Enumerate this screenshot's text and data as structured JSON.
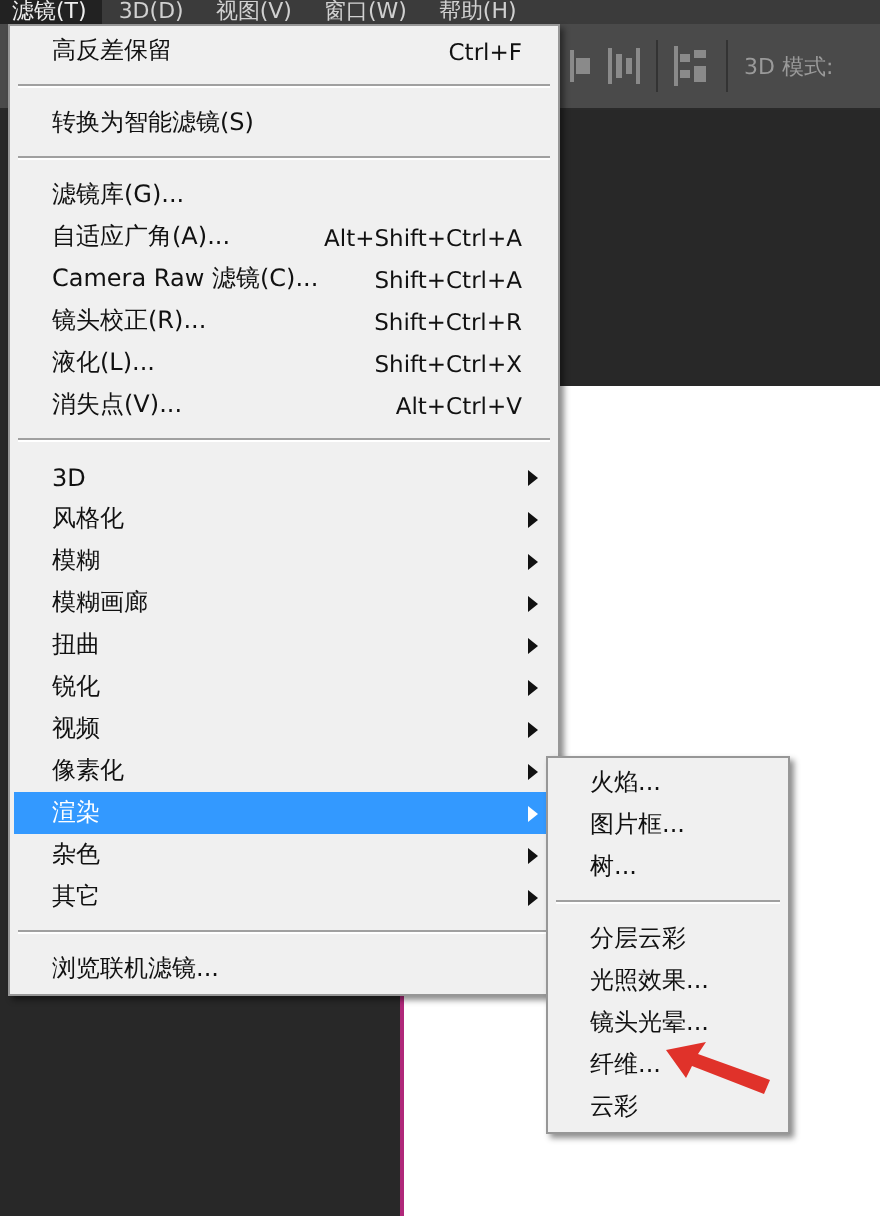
{
  "menubar": [
    {
      "label": "滤镜(T)",
      "selected": true
    },
    {
      "label": "3D(D)",
      "selected": false
    },
    {
      "label": "视图(V)",
      "selected": false
    },
    {
      "label": "窗口(W)",
      "selected": false
    },
    {
      "label": "帮助(H)",
      "selected": false
    }
  ],
  "toolbar": {
    "mode_label": "3D 模式:"
  },
  "menu": [
    {
      "kind": "item",
      "label": "高反差保留",
      "shortcut": "Ctrl+F",
      "submenu": false,
      "selected": false
    },
    {
      "kind": "separator"
    },
    {
      "kind": "item",
      "label": "转换为智能滤镜(S)",
      "submenu": false,
      "selected": false
    },
    {
      "kind": "separator"
    },
    {
      "kind": "item",
      "label": "滤镜库(G)...",
      "submenu": false,
      "selected": false
    },
    {
      "kind": "item",
      "label": "自适应广角(A)...",
      "shortcut": "Alt+Shift+Ctrl+A",
      "submenu": false,
      "selected": false
    },
    {
      "kind": "item",
      "label": "Camera Raw 滤镜(C)...",
      "shortcut": "Shift+Ctrl+A",
      "submenu": false,
      "selected": false
    },
    {
      "kind": "item",
      "label": "镜头校正(R)...",
      "shortcut": "Shift+Ctrl+R",
      "submenu": false,
      "selected": false
    },
    {
      "kind": "item",
      "label": "液化(L)...",
      "shortcut": "Shift+Ctrl+X",
      "submenu": false,
      "selected": false
    },
    {
      "kind": "item",
      "label": "消失点(V)...",
      "shortcut": "Alt+Ctrl+V",
      "submenu": false,
      "selected": false
    },
    {
      "kind": "separator"
    },
    {
      "kind": "item",
      "label": "3D",
      "submenu": true,
      "selected": false
    },
    {
      "kind": "item",
      "label": "风格化",
      "submenu": true,
      "selected": false
    },
    {
      "kind": "item",
      "label": "模糊",
      "submenu": true,
      "selected": false
    },
    {
      "kind": "item",
      "label": "模糊画廊",
      "submenu": true,
      "selected": false
    },
    {
      "kind": "item",
      "label": "扭曲",
      "submenu": true,
      "selected": false
    },
    {
      "kind": "item",
      "label": "锐化",
      "submenu": true,
      "selected": false
    },
    {
      "kind": "item",
      "label": "视频",
      "submenu": true,
      "selected": false
    },
    {
      "kind": "item",
      "label": "像素化",
      "submenu": true,
      "selected": false
    },
    {
      "kind": "item",
      "label": "渲染",
      "submenu": true,
      "selected": true
    },
    {
      "kind": "item",
      "label": "杂色",
      "submenu": true,
      "selected": false
    },
    {
      "kind": "item",
      "label": "其它",
      "submenu": true,
      "selected": false
    },
    {
      "kind": "separator"
    },
    {
      "kind": "item",
      "label": "浏览联机滤镜...",
      "submenu": false,
      "selected": false
    }
  ],
  "submenu": [
    {
      "kind": "item",
      "label": "火焰..."
    },
    {
      "kind": "item",
      "label": "图片框..."
    },
    {
      "kind": "item",
      "label": "树..."
    },
    {
      "kind": "separator"
    },
    {
      "kind": "item",
      "label": "分层云彩"
    },
    {
      "kind": "item",
      "label": "光照效果..."
    },
    {
      "kind": "item",
      "label": "镜头光晕..."
    },
    {
      "kind": "item",
      "label": "纤维..."
    },
    {
      "kind": "item",
      "label": "云彩"
    }
  ]
}
